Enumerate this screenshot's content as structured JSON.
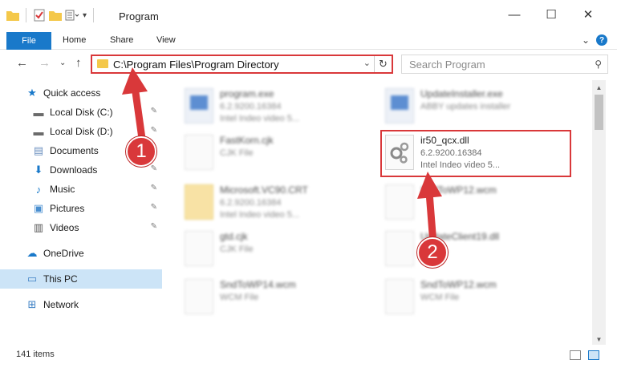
{
  "window": {
    "title": "Program",
    "minimize": "—",
    "maximize": "☐",
    "close": "✕",
    "expand_ribbon": "⌄",
    "help": "?"
  },
  "ribbon": {
    "file": "File",
    "home": "Home",
    "share": "Share",
    "view": "View"
  },
  "navigation": {
    "back": "←",
    "forward": "→",
    "recent": "⌄",
    "up": "↑",
    "address": "C:\\Program Files\\Program Directory",
    "address_dropdown": "⌄",
    "refresh": "↻",
    "search_placeholder": "Search Program",
    "search_glyph": "⚲"
  },
  "sidebar": {
    "items": [
      {
        "label": "Quick access",
        "icon": "star-icon",
        "glyph": "★",
        "color": "#1979ca",
        "pinned": false
      },
      {
        "label": "Local Disk (C:)",
        "icon": "drive-icon",
        "glyph": "▬",
        "color": "#6b6b6b",
        "pinned": true
      },
      {
        "label": "Local Disk (D:)",
        "icon": "drive-icon",
        "glyph": "▬",
        "color": "#6b6b6b",
        "pinned": true
      },
      {
        "label": "Documents",
        "icon": "documents-icon",
        "glyph": "▤",
        "color": "#6b8fbf",
        "pinned": true
      },
      {
        "label": "Downloads",
        "icon": "download-icon",
        "glyph": "⬇",
        "color": "#1979ca",
        "pinned": true
      },
      {
        "label": "Music",
        "icon": "music-icon",
        "glyph": "♪",
        "color": "#1979ca",
        "pinned": true
      },
      {
        "label": "Pictures",
        "icon": "pictures-icon",
        "glyph": "▣",
        "color": "#4a8fd0",
        "pinned": true
      },
      {
        "label": "Videos",
        "icon": "video-icon",
        "glyph": "▥",
        "color": "#555555",
        "pinned": true
      },
      {
        "label": "OneDrive",
        "icon": "cloud-icon",
        "glyph": "☁",
        "color": "#1979ca",
        "pinned": false
      },
      {
        "label": "This PC",
        "icon": "computer-icon",
        "glyph": "▭",
        "color": "#3b7fc4",
        "pinned": false
      },
      {
        "label": "Network",
        "icon": "network-icon",
        "glyph": "⊞",
        "color": "#3b7fc4",
        "pinned": false
      }
    ],
    "pin_glyph": "📌"
  },
  "files": [
    {
      "name": "program.exe",
      "line2": "6.2.9200.16384",
      "line3": "Intel Indeo video 5...",
      "kind": "exe",
      "blurred": true
    },
    {
      "name": "UpdateInstaller.exe",
      "line2": "ABBY updates installer",
      "line3": "",
      "kind": "exe",
      "blurred": true
    },
    {
      "name": "FastKorn.cjk",
      "line2": "CJK File",
      "line3": "",
      "kind": "doc",
      "blurred": true
    },
    {
      "name": "ir50_qcx.dll",
      "line2": "6.2.9200.16384",
      "line3": "Intel Indeo video 5...",
      "kind": "dll",
      "blurred": false
    },
    {
      "name": "Microsoft.VC90.CRT",
      "line2": "6.2.9200.16384",
      "line3": "Intel Indeo video 5...",
      "kind": "folder",
      "blurred": true
    },
    {
      "name": "SndToWP12.wcm",
      "line2": "",
      "line3": "",
      "kind": "doc",
      "blurred": true
    },
    {
      "name": "gtd.cjk",
      "line2": "CJK File",
      "line3": "",
      "kind": "doc",
      "blurred": true
    },
    {
      "name": "UpdateClient19.dll",
      "line2": "ce DLL",
      "line3": "",
      "kind": "dll",
      "blurred": true
    },
    {
      "name": "SndToWP14.wcm",
      "line2": "WCM File",
      "line3": "",
      "kind": "doc",
      "blurred": true
    },
    {
      "name": "SndToWP12.wcm",
      "line2": "WCM File",
      "line3": "",
      "kind": "doc",
      "blurred": true
    }
  ],
  "annotations": {
    "step1": "1",
    "step2": "2",
    "accent": "#d9383a"
  },
  "status": {
    "count": "141 items"
  }
}
